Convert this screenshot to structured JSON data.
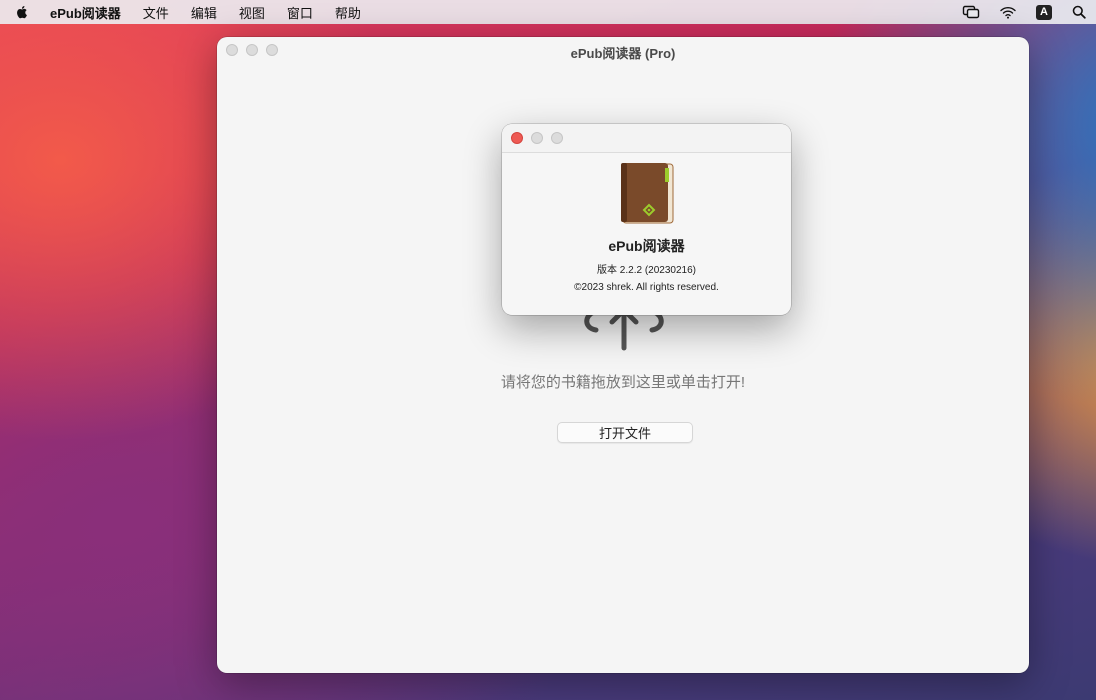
{
  "menubar": {
    "app_name": "ePub阅读器",
    "items": [
      "文件",
      "编辑",
      "视图",
      "窗口",
      "帮助"
    ],
    "keyboard_badge": "A"
  },
  "main_window": {
    "title": "ePub阅读器 (Pro)",
    "drop_hint": "请将您的书籍拖放到这里或单击打开!",
    "open_button_label": "打开文件"
  },
  "about_dialog": {
    "app_name": "ePub阅读器",
    "version": "版本 2.2.2 (20230216)",
    "copyright": "©2023 shrek. All rights reserved."
  },
  "colors": {
    "close_button": "#ee5a54",
    "book_cover": "#7a4a2a",
    "book_accent": "#9ccc2c"
  }
}
